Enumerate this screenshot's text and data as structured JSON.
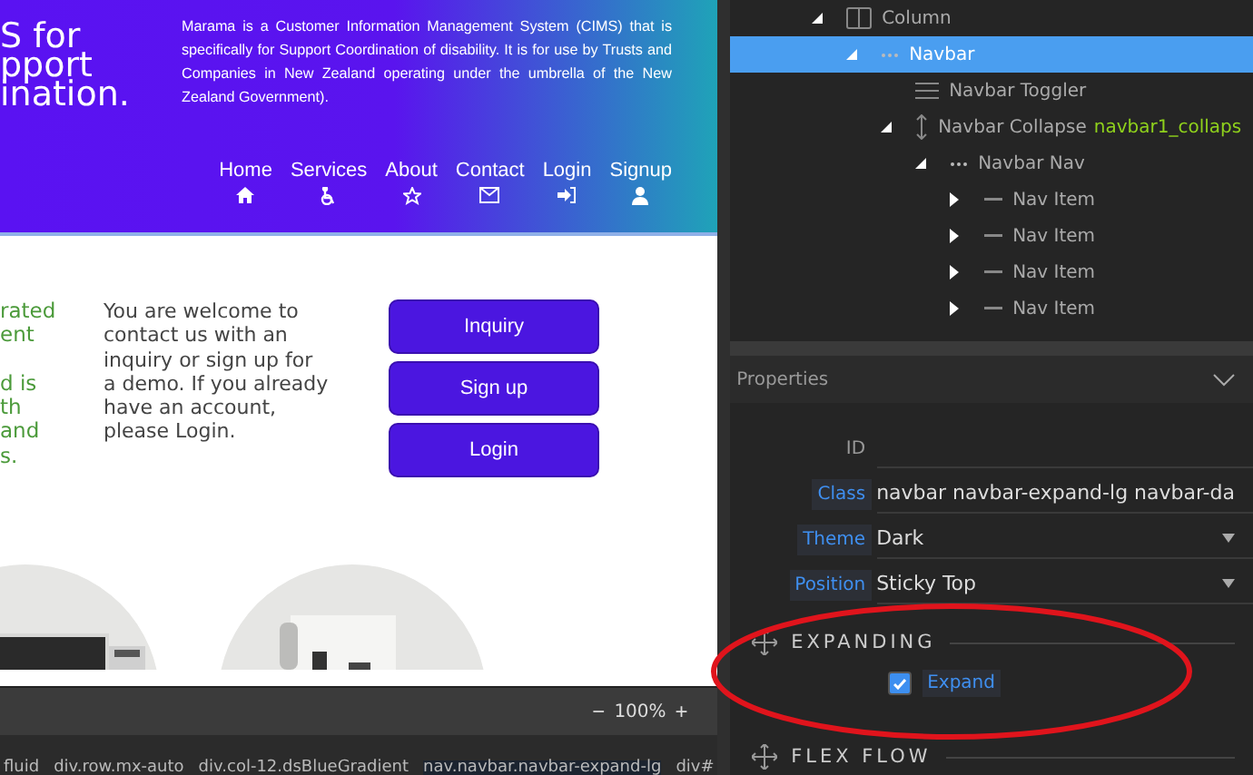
{
  "site": {
    "heading_lines": [
      "S for",
      "pport",
      "ination."
    ],
    "description": "Marama is a Customer Information Management System (CIMS) that is specifically for Support Coordination of disability.   It is for use by Trusts and Companies in New Zealand operating under the umbrella of the New Zealand Government).",
    "nav": [
      "Home",
      "Services",
      "About",
      "Contact",
      "Login",
      "Signup"
    ],
    "partial_paragraphs": [
      [
        "rated",
        "ent"
      ],
      [
        "d is",
        "th",
        "and",
        "s."
      ]
    ],
    "welcome": "You are welcome to contact us with an inquiry or sign up for a demo. If you already have an account, please Login.",
    "buttons": [
      "Inquiry",
      "Sign up",
      "Login"
    ]
  },
  "zoom": {
    "minus": "−",
    "value": "100%",
    "plus": "+"
  },
  "breadcrumb": [
    "fluid",
    "div.row.mx-auto",
    "div.col-12.dsBlueGradient",
    "nav.navbar.navbar-expand-lg",
    "div#"
  ],
  "tree": [
    {
      "label": "Column",
      "kind": "column",
      "expanded": true,
      "selected": false,
      "children": [
        {
          "label": "Navbar",
          "kind": "navbar",
          "expanded": true,
          "selected": true,
          "children": [
            {
              "label": "Navbar Toggler",
              "kind": "toggler",
              "selected": false
            },
            {
              "label": "Navbar Collapse",
              "id": "navbar1_collaps",
              "kind": "collapse",
              "expanded": true,
              "selected": false,
              "children": [
                {
                  "label": "Navbar Nav",
                  "kind": "navbar",
                  "expanded": true,
                  "selected": false,
                  "children": [
                    {
                      "label": "Nav Item",
                      "kind": "item",
                      "expanded": false,
                      "selected": false
                    },
                    {
                      "label": "Nav Item",
                      "kind": "item",
                      "expanded": false,
                      "selected": false
                    },
                    {
                      "label": "Nav Item",
                      "kind": "item",
                      "expanded": false,
                      "selected": false
                    },
                    {
                      "label": "Nav Item",
                      "kind": "item",
                      "expanded": false,
                      "selected": false
                    }
                  ]
                }
              ]
            }
          ]
        }
      ]
    }
  ],
  "properties": {
    "title": "Properties",
    "fields": [
      {
        "label": "ID",
        "kind": "text"
      },
      {
        "label": "Class",
        "kind": "text",
        "value": "navbar navbar-expand-lg navbar-da"
      },
      {
        "label": "Theme",
        "kind": "select",
        "value": "Dark"
      },
      {
        "label": "Position",
        "kind": "select",
        "value": "Sticky Top"
      }
    ],
    "sections": [
      {
        "title": "EXPANDING",
        "options": [
          {
            "label": "Expand",
            "checked": true
          }
        ]
      },
      {
        "title": "FLEX FLOW"
      }
    ]
  }
}
